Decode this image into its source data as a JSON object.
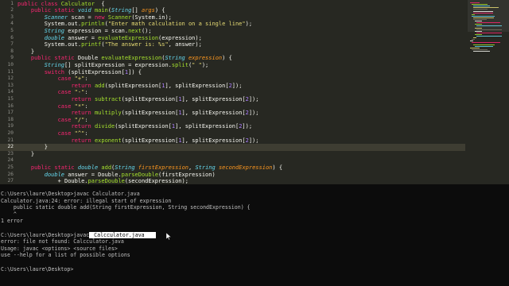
{
  "editor": {
    "lines": [
      {
        "n": "1",
        "tokens": [
          [
            "kw",
            "public class "
          ],
          [
            "fn",
            "Calculator"
          ],
          [
            "",
            "  {"
          ]
        ]
      },
      {
        "n": "2",
        "tokens": [
          [
            "",
            "    "
          ],
          [
            "kw",
            "public static "
          ],
          [
            "ty",
            "void "
          ],
          [
            "fn",
            "main"
          ],
          [
            "",
            "("
          ],
          [
            "ty",
            "String"
          ],
          [
            "",
            "[] "
          ],
          [
            "pa",
            "args"
          ],
          [
            "",
            ") {"
          ]
        ]
      },
      {
        "n": "3",
        "tokens": [
          [
            "",
            "        "
          ],
          [
            "ty",
            "Scanner"
          ],
          [
            "",
            " scan = "
          ],
          [
            "kw",
            "new "
          ],
          [
            "fn",
            "Scanner"
          ],
          [
            "",
            "(System.in);"
          ]
        ]
      },
      {
        "n": "4",
        "tokens": [
          [
            "",
            "        System.out."
          ],
          [
            "fn",
            "println"
          ],
          [
            "",
            "("
          ],
          [
            "st",
            "\"Enter math calculation on a single line\""
          ],
          [
            "",
            ");"
          ]
        ]
      },
      {
        "n": "5",
        "tokens": [
          [
            "",
            "        "
          ],
          [
            "ty",
            "String"
          ],
          [
            "",
            " expression = scan."
          ],
          [
            "fn",
            "next"
          ],
          [
            "",
            "();"
          ]
        ]
      },
      {
        "n": "6",
        "tokens": [
          [
            "",
            "        "
          ],
          [
            "ty",
            "double"
          ],
          [
            "",
            " answer = "
          ],
          [
            "fn",
            "evaluateExpression"
          ],
          [
            "",
            "(expression);"
          ]
        ]
      },
      {
        "n": "7",
        "tokens": [
          [
            "",
            "        System.out."
          ],
          [
            "fn",
            "printf"
          ],
          [
            "",
            "("
          ],
          [
            "st",
            "\"The answer is: %s\""
          ],
          [
            "",
            ", answer);"
          ]
        ]
      },
      {
        "n": "8",
        "tokens": [
          [
            "",
            "    }"
          ]
        ]
      },
      {
        "n": "9",
        "tokens": [
          [
            "",
            "    "
          ],
          [
            "kw",
            "public static "
          ],
          [
            "",
            "Double "
          ],
          [
            "fn",
            "evaluateExpression"
          ],
          [
            "",
            "("
          ],
          [
            "ty",
            "String "
          ],
          [
            "pa",
            "expression"
          ],
          [
            "",
            ") {"
          ]
        ]
      },
      {
        "n": "10",
        "tokens": [
          [
            "",
            "        "
          ],
          [
            "ty",
            "String"
          ],
          [
            "",
            "[] splitExpression = expression."
          ],
          [
            "fn",
            "split"
          ],
          [
            "",
            "("
          ],
          [
            "st",
            "\" \""
          ],
          [
            "",
            ");"
          ]
        ]
      },
      {
        "n": "11",
        "tokens": [
          [
            "",
            "        "
          ],
          [
            "kw",
            "switch "
          ],
          [
            "",
            "(splitExpression["
          ],
          [
            "nu",
            "1"
          ],
          [
            "",
            "]) {"
          ]
        ]
      },
      {
        "n": "12",
        "tokens": [
          [
            "",
            "            "
          ],
          [
            "kw",
            "case "
          ],
          [
            "st",
            "\"+\""
          ],
          [
            "",
            ":"
          ]
        ]
      },
      {
        "n": "13",
        "tokens": [
          [
            "",
            "                "
          ],
          [
            "kw",
            "return "
          ],
          [
            "fn",
            "add"
          ],
          [
            "",
            "(splitExpression["
          ],
          [
            "nu",
            "1"
          ],
          [
            "",
            "], splitExpression["
          ],
          [
            "nu",
            "2"
          ],
          [
            "",
            "]);"
          ]
        ]
      },
      {
        "n": "14",
        "tokens": [
          [
            "",
            "            "
          ],
          [
            "kw",
            "case "
          ],
          [
            "st",
            "\"-\""
          ],
          [
            "",
            ":"
          ]
        ]
      },
      {
        "n": "15",
        "tokens": [
          [
            "",
            "                "
          ],
          [
            "kw",
            "return "
          ],
          [
            "fn",
            "subtract"
          ],
          [
            "",
            "(splitExpression["
          ],
          [
            "nu",
            "1"
          ],
          [
            "",
            "], splitExpression["
          ],
          [
            "nu",
            "2"
          ],
          [
            "",
            "]);"
          ]
        ]
      },
      {
        "n": "16",
        "tokens": [
          [
            "",
            "            "
          ],
          [
            "kw",
            "case "
          ],
          [
            "st",
            "\"*\""
          ],
          [
            "",
            ":"
          ]
        ]
      },
      {
        "n": "17",
        "tokens": [
          [
            "",
            "                "
          ],
          [
            "kw",
            "return "
          ],
          [
            "fn",
            "multiply"
          ],
          [
            "",
            "(splitExpression["
          ],
          [
            "nu",
            "1"
          ],
          [
            "",
            "], splitExpression["
          ],
          [
            "nu",
            "2"
          ],
          [
            "",
            "]);"
          ]
        ]
      },
      {
        "n": "18",
        "tokens": [
          [
            "",
            "            "
          ],
          [
            "kw",
            "case "
          ],
          [
            "st",
            "\"/\""
          ],
          [
            "",
            ":"
          ]
        ]
      },
      {
        "n": "19",
        "tokens": [
          [
            "",
            "                "
          ],
          [
            "kw",
            "return "
          ],
          [
            "fn",
            "divide"
          ],
          [
            "",
            "(splitExpression["
          ],
          [
            "nu",
            "1"
          ],
          [
            "",
            "], splitExpression["
          ],
          [
            "nu",
            "2"
          ],
          [
            "",
            "]);"
          ]
        ]
      },
      {
        "n": "20",
        "tokens": [
          [
            "",
            "            "
          ],
          [
            "kw",
            "case "
          ],
          [
            "st",
            "\"^\""
          ],
          [
            "",
            ":"
          ]
        ]
      },
      {
        "n": "21",
        "tokens": [
          [
            "",
            "                "
          ],
          [
            "kw",
            "return "
          ],
          [
            "fn",
            "exponent"
          ],
          [
            "",
            "(splitExpression["
          ],
          [
            "nu",
            "1"
          ],
          [
            "",
            "], splitExpression["
          ],
          [
            "nu",
            "2"
          ],
          [
            "",
            "]);"
          ]
        ]
      },
      {
        "n": "22",
        "tokens": [
          [
            "",
            "        }"
          ]
        ],
        "active": true
      },
      {
        "n": "23",
        "tokens": [
          [
            "",
            "    }"
          ]
        ]
      },
      {
        "n": "24",
        "tokens": [
          [
            "",
            ""
          ]
        ]
      },
      {
        "n": "25",
        "tokens": [
          [
            "",
            "    "
          ],
          [
            "kw",
            "public static "
          ],
          [
            "ty",
            "double "
          ],
          [
            "fn",
            "add"
          ],
          [
            "",
            "("
          ],
          [
            "ty",
            "String "
          ],
          [
            "pa",
            "firstExpression"
          ],
          [
            "",
            ", "
          ],
          [
            "ty",
            "String "
          ],
          [
            "pa",
            "secondExpression"
          ],
          [
            "",
            ") {"
          ]
        ]
      },
      {
        "n": "26",
        "tokens": [
          [
            "",
            "        "
          ],
          [
            "ty",
            "double"
          ],
          [
            "",
            " answer = Double."
          ],
          [
            "fn",
            "parseDouble"
          ],
          [
            "",
            "(firstExpression)"
          ]
        ]
      },
      {
        "n": "27",
        "tokens": [
          [
            "",
            "            + Double."
          ],
          [
            "fn",
            "parseDouble"
          ],
          [
            "",
            "(secondExpression);"
          ]
        ]
      }
    ]
  },
  "terminal": {
    "lines": [
      "C:\\Users\\laure\\Desktop>javac Calculator.java",
      "Calculator.java:24: error: illegal start of expression",
      "    public static double add(String firstExpression, String secondExpression) {",
      "    ^",
      "1 error",
      "",
      "C:\\Users\\laure\\Desktop>javac",
      "error: file not found: Calcculator.java",
      "Usage: javac <options> <source files>",
      "use --help for a list of possible options",
      "",
      "C:\\Users\\laure\\Desktop>"
    ],
    "selected_text": " Calcculator.java   "
  },
  "colors": {
    "editor_bg": "#272822",
    "keyword": "#f92672",
    "type": "#66d9ef",
    "function": "#a6e22e",
    "string": "#e6db74",
    "parameter": "#fd971f",
    "number": "#ae81ff",
    "terminal_bg": "#0c0c0c",
    "terminal_fg": "#c0c0c0"
  }
}
